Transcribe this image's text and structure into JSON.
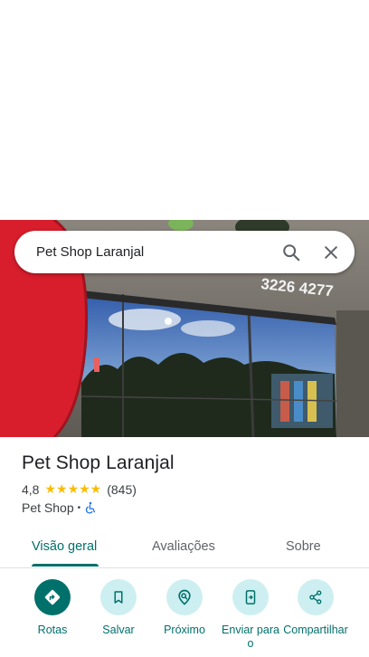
{
  "search": {
    "query": "Pet Shop Laranjal",
    "search_icon": "search-icon",
    "close_icon": "close-icon"
  },
  "photo": {
    "storefront_sign_text": "3226 4277"
  },
  "place": {
    "name": "Pet Shop Laranjal",
    "rating": "4,8",
    "stars": "★★★★★",
    "review_count": "(845)",
    "category": "Pet Shop",
    "separator": "•",
    "accessibility_icon": "wheelchair-icon"
  },
  "tabs": [
    {
      "label": "Visão geral",
      "active": true
    },
    {
      "label": "Avaliações",
      "active": false
    },
    {
      "label": "Sobre",
      "active": false
    }
  ],
  "actions": [
    {
      "label": "Rotas",
      "icon": "directions-icon"
    },
    {
      "label": "Salvar",
      "icon": "bookmark-icon"
    },
    {
      "label": "Próximo",
      "icon": "nearby-icon"
    },
    {
      "label": "Enviar para o",
      "icon": "send-to-phone-icon"
    },
    {
      "label": "Compartilhar",
      "icon": "share-icon"
    }
  ],
  "colors": {
    "accent": "#00706b",
    "accent_light": "#cdeff1",
    "star": "#fbbc04"
  }
}
